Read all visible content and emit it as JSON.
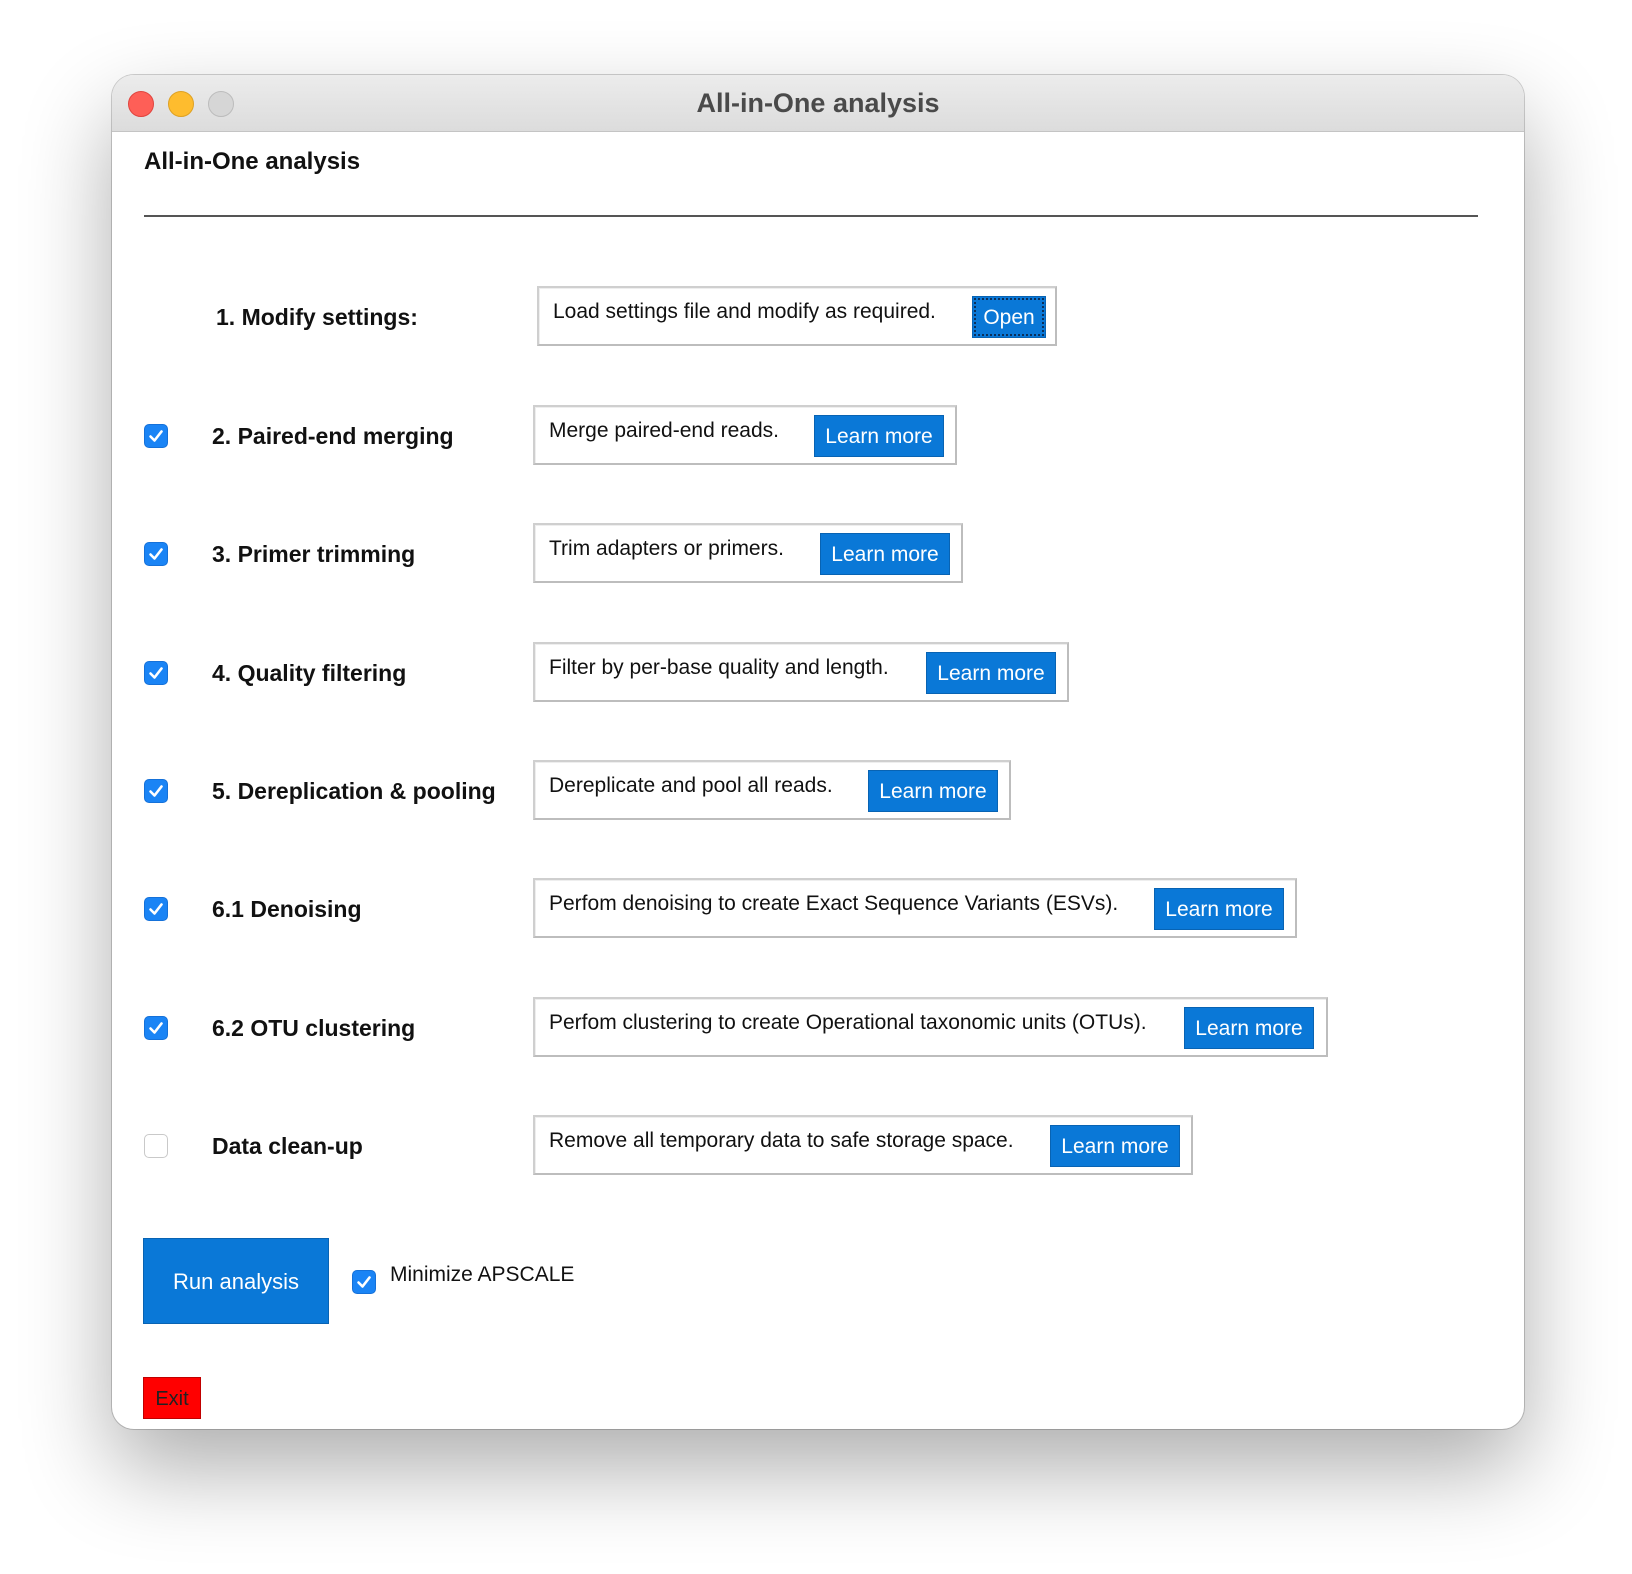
{
  "window": {
    "title": "All-in-One analysis"
  },
  "main": {
    "heading": "All-in-One analysis",
    "steps": [
      {
        "label": "1. Modify settings:",
        "checkbox": null,
        "description": "Load settings file and modify as required.",
        "button": "Open"
      },
      {
        "label": "2. Paired-end merging",
        "checkbox": true,
        "description": "Merge paired-end reads.",
        "button": "Learn more"
      },
      {
        "label": "3. Primer trimming",
        "checkbox": true,
        "description": "Trim adapters or primers.",
        "button": "Learn more"
      },
      {
        "label": "4. Quality filtering",
        "checkbox": true,
        "description": "Filter by per-base quality and length.",
        "button": "Learn more"
      },
      {
        "label": "5. Dereplication & pooling",
        "checkbox": true,
        "description": "Dereplicate and pool all reads.",
        "button": "Learn more"
      },
      {
        "label": "6.1 Denoising",
        "checkbox": true,
        "description": "Perfom denoising to create Exact Sequence Variants (ESVs).",
        "button": "Learn more"
      },
      {
        "label": "6.2 OTU clustering",
        "checkbox": true,
        "description": "Perfom clustering to create Operational taxonomic units (OTUs).",
        "button": "Learn more"
      },
      {
        "label": "Data clean-up",
        "checkbox": false,
        "description": "Remove all temporary data to safe storage space.",
        "button": "Learn more"
      }
    ],
    "run_button": "Run analysis",
    "minimize_label": "Minimize APSCALE",
    "minimize_checked": true,
    "exit_button": "Exit"
  },
  "colors": {
    "button_blue": "#0a78d7",
    "checkbox_blue": "#1a84f5",
    "exit_red": "#ff0000"
  }
}
